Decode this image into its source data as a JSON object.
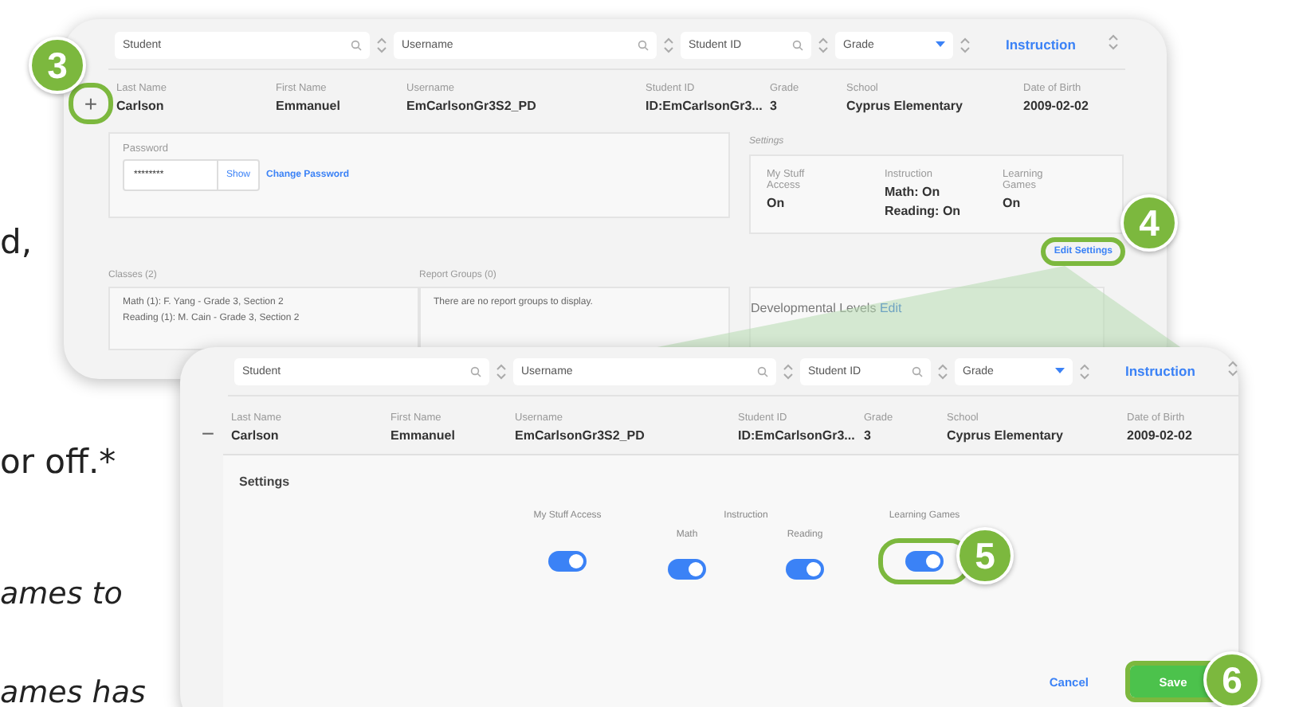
{
  "side_text": [
    {
      "text": "d,",
      "italic": false
    },
    {
      "text": "or off.*",
      "italic": false
    },
    {
      "text": "ames to",
      "italic": true
    },
    {
      "text": "ames has",
      "italic": true
    }
  ],
  "overview_panel": {
    "filters": [
      {
        "kind": "search",
        "placeholder": "Student"
      },
      {
        "kind": "search",
        "placeholder": "Username"
      },
      {
        "kind": "search",
        "placeholder": "Student ID"
      },
      {
        "kind": "select",
        "placeholder": "Grade"
      },
      {
        "kind": "link",
        "label": "Instruction"
      }
    ],
    "expand_button": {
      "label": "+",
      "highlighted": true,
      "callout": "3"
    },
    "fields": [
      {
        "label": "Last Name",
        "value": "Carlson"
      },
      {
        "label": "First Name",
        "value": "Emmanuel"
      },
      {
        "label": "Username",
        "value": "EmCarlsonGr3S2_PD"
      },
      {
        "label": "Student ID",
        "value": "ID:EmCarlsonGr3..."
      },
      {
        "label": "Grade",
        "value": "3"
      },
      {
        "label": "School",
        "value": "Cyprus Elementary"
      },
      {
        "label": "Date of Birth",
        "value": "2009-02-02"
      }
    ],
    "settings_caption": "Settings",
    "password": {
      "label": "Password",
      "value": "********",
      "show": "Show",
      "link": "Change Password"
    },
    "settings": [
      {
        "label": "My Stuff Access",
        "values": [
          "On"
        ]
      },
      {
        "label": "Instruction",
        "values": [
          "Math: On",
          "Reading: On"
        ]
      },
      {
        "label": "Learning Games",
        "values": [
          "On"
        ]
      }
    ],
    "edit_settings": {
      "label": "Edit Settings",
      "highlighted": true,
      "callout": "4"
    },
    "classes": {
      "heading": "Classes (2)",
      "items": [
        "Math (1): F. Yang - Grade 3, Section 2",
        "Reading (1): M. Cain - Grade 3, Section 2"
      ]
    },
    "report_groups": {
      "heading": "Report Groups (0)",
      "empty": "There are no report groups to display."
    },
    "developmental_levels": {
      "label": "Developmental Levels",
      "link": "Edit"
    }
  },
  "settings_panel": {
    "filters": [
      {
        "kind": "search",
        "placeholder": "Student"
      },
      {
        "kind": "search",
        "placeholder": "Username"
      },
      {
        "kind": "search",
        "placeholder": "Student ID"
      },
      {
        "kind": "select",
        "placeholder": "Grade"
      },
      {
        "kind": "link",
        "label": "Instruction"
      }
    ],
    "collapse_button": {
      "label": "−"
    },
    "fields": [
      {
        "label": "Last Name",
        "value": "Carlson"
      },
      {
        "label": "First Name",
        "value": "Emmanuel"
      },
      {
        "label": "Username",
        "value": "EmCarlsonGr3S2_PD"
      },
      {
        "label": "Student ID",
        "value": "ID:EmCarlsonGr3..."
      },
      {
        "label": "Grade",
        "value": "3"
      },
      {
        "label": "School",
        "value": "Cyprus Elementary"
      },
      {
        "label": "Date of Birth",
        "value": "2009-02-02"
      }
    ],
    "title": "Settings",
    "groups": [
      {
        "label": "My Stuff Access",
        "toggles": [
          {
            "on": true,
            "highlighted": false
          }
        ]
      },
      {
        "label": "Instruction",
        "toggles": [
          {
            "label": "Math",
            "on": true,
            "highlighted": false
          },
          {
            "label": "Reading",
            "on": true,
            "highlighted": false
          }
        ]
      },
      {
        "label": "Learning Games",
        "toggles": [
          {
            "on": true,
            "highlighted": true,
            "callout": "5"
          }
        ]
      }
    ],
    "cancel": "Cancel",
    "save": {
      "label": "Save",
      "highlighted": true,
      "callout": "6"
    }
  }
}
